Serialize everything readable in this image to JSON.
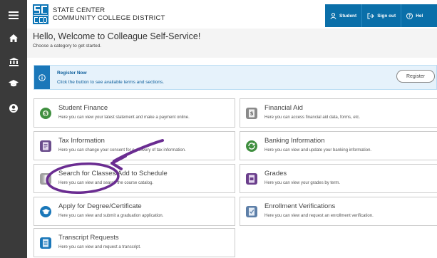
{
  "header": {
    "college_line1": "State Center",
    "college_line2": "Community College District",
    "logo_letters": [
      "S",
      "C",
      "C",
      "C",
      "D"
    ],
    "nav": [
      {
        "label": "Student",
        "icon": "user-icon"
      },
      {
        "label": "Sign out",
        "icon": "sign-out-icon"
      },
      {
        "label": "Hel",
        "icon": "help-icon"
      }
    ]
  },
  "sidebar": {
    "items": [
      {
        "icon": "menu-icon"
      },
      {
        "icon": "home-icon"
      },
      {
        "icon": "bank-icon"
      },
      {
        "icon": "graduation-cap-icon"
      },
      {
        "icon": "user-circle-icon"
      }
    ]
  },
  "welcome": {
    "title": "Hello, Welcome to Colleague Self-Service!",
    "subtitle": "Choose a category to get started."
  },
  "banner": {
    "title": "Register Now",
    "text": "Click the button to see available terms and sections.",
    "button_label": "Register"
  },
  "tiles": [
    {
      "title": "Student Finance",
      "desc": "Here you can view your latest statement and make a payment online.",
      "icon": "dollar-icon",
      "color": "#3f8f3f"
    },
    {
      "title": "Financial Aid",
      "desc": "Here you can access financial aid data, forms, etc.",
      "icon": "document-dollar-icon",
      "color": "#7a7a7a"
    },
    {
      "title": "Tax Information",
      "desc": "Here you can change your consent for e-delivery of tax information.",
      "icon": "tax-form-icon",
      "color": "#6b4d8c"
    },
    {
      "title": "Banking Information",
      "desc": "Here you can view and update your banking information.",
      "icon": "banking-refresh-icon",
      "color": "#3f8f3f"
    },
    {
      "title": "Search for Classes/Add to Schedule",
      "desc": "Here you can view and search the course catalog.",
      "icon": "catalog-icon",
      "color": "#9a9a9a"
    },
    {
      "title": "Grades",
      "desc": "Here you can view your grades by term.",
      "icon": "grades-icon",
      "color": "#6b3f8c"
    },
    {
      "title": "Apply for Degree/Certificate",
      "desc": "Here you can view and submit a graduation application.",
      "icon": "graduation-cap-icon",
      "color": "#1a77b9"
    },
    {
      "title": "Enrollment Verifications",
      "desc": "Here you can view and request an enrollment verification.",
      "icon": "checklist-icon",
      "color": "#5d7fa8"
    },
    {
      "title": "Transcript Requests",
      "desc": "Here you can view and request a transcript.",
      "icon": "transcript-icon",
      "color": "#1a77b9"
    }
  ],
  "annotation": {
    "color": "#6a2c91"
  }
}
